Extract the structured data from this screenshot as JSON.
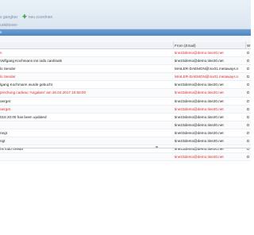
{
  "toolbar": {
    "link1": "s gangbar",
    "add_label": "neu zuordnen",
    "link2": "unktionen"
  },
  "columns": {
    "from": "From (Email)",
    "w": "W"
  },
  "rows": [
    {
      "subject": "n",
      "subject_color": "red",
      "from": "tine23demo@demo.tine20.net",
      "from_color": "red",
      "w": "D"
    },
    {
      "subject": "Volfgang Kochmann ins iodo cardinals",
      "subject_color": "dark",
      "from": "tine23demo@demo.tine20.net",
      "from_color": "dark",
      "w": "D"
    },
    {
      "subject": "lo Sender",
      "subject_color": "dark",
      "from": "MAILER-DAEMON@mx01.metaways.n",
      "from_color": "dark",
      "w": "D"
    },
    {
      "subject": "lo Sender",
      "subject_color": "red",
      "from": "MAILER-DAEMON@mx01.metaways.n",
      "from_color": "red",
      "w": "D"
    },
    {
      "subject": "lgang Kochmann wurde gebucht",
      "subject_color": "dark",
      "from": "tine23demo@demo.tine20.net",
      "from_color": "dark",
      "w": "D"
    },
    {
      "subject": "prechung cadeau 'Angaben' am 26.04.2017 15:58:00",
      "subject_color": "red",
      "from": "tine23demo@demo.tine20.net",
      "from_color": "red",
      "w": "D"
    },
    {
      "subject": "oerget",
      "subject_color": "dark",
      "from": "tine23demo@demo.tine20.net",
      "from_color": "dark",
      "w": "D"
    },
    {
      "subject": "oerget",
      "subject_color": "red",
      "from": "tine23demo@demo.tine20.net",
      "from_color": "red",
      "w": "D"
    },
    {
      "subject": "018 20:00 has been updated",
      "subject_color": "dark",
      "from": "tine23demo@demo.tine20.net",
      "from_color": "dark",
      "w": "D"
    },
    {
      "subject": "",
      "subject_color": "dark",
      "from": "tine23demo@demo.tine20.net",
      "from_color": "dark",
      "w": "D"
    },
    {
      "subject": "negt",
      "subject_color": "dark",
      "from": "tine03demo@demo.tine20.net",
      "from_color": "dark",
      "w": "D"
    },
    {
      "subject": "ngt",
      "subject_color": "dark",
      "from": "tine23demo@demo.tine20.net",
      "from_color": "dark",
      "w": "D"
    },
    {
      "subject": "hs iodo cleisia",
      "subject_color": "dark",
      "from": "tine23demo@demo.tine20.net",
      "from_color": "dark",
      "w": "D"
    },
    {
      "subject": "",
      "subject_color": "red",
      "from": "tine23demo@demo.tine20.net",
      "from_color": "red",
      "w": "D"
    }
  ]
}
